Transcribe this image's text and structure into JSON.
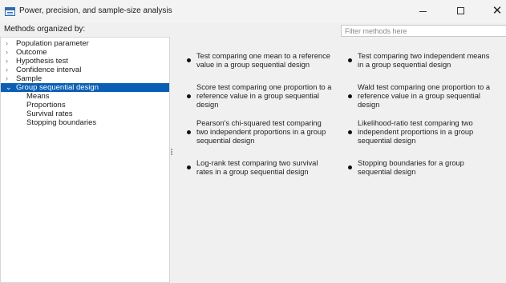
{
  "window": {
    "title": "Power, precision, and sample-size analysis"
  },
  "sidebar": {
    "heading": "Methods organized by:",
    "items": [
      {
        "label": "Population parameter",
        "chevron": "›"
      },
      {
        "label": "Outcome",
        "chevron": "›"
      },
      {
        "label": "Hypothesis test",
        "chevron": "›"
      },
      {
        "label": "Confidence interval",
        "chevron": "›"
      },
      {
        "label": "Sample",
        "chevron": "›"
      },
      {
        "label": "Group sequential design",
        "chevron": "⌄",
        "selected": true
      }
    ],
    "children": [
      "Means",
      "Proportions",
      "Survival rates",
      "Stopping boundaries"
    ]
  },
  "filter": {
    "placeholder": "Filter methods here",
    "value": ""
  },
  "methods": [
    "Test comparing one mean to a reference value in a group sequential design",
    "Test comparing two independent means in a group sequential design",
    "Score test comparing one proportion to a reference value in a group sequential design",
    "Wald test comparing one proportion to a reference value in a group sequential design",
    "Pearson's chi-squared test comparing two independent proportions in a group sequential design",
    "Likelihood-ratio test comparing two independent proportions in a group sequential design",
    "Log-rank test comparing two survival rates in a group sequential design",
    "Stopping boundaries for a group sequential design"
  ],
  "icons": {
    "app": "table-window-icon",
    "minimize": "minimize-icon",
    "maximize": "maximize-icon",
    "close": "close-icon",
    "collapsed": "chevron-right-icon",
    "expanded": "chevron-down-icon"
  },
  "colors": {
    "selection": "#0a5fb4",
    "background": "#f0f0f0",
    "panel": "#ffffff"
  }
}
